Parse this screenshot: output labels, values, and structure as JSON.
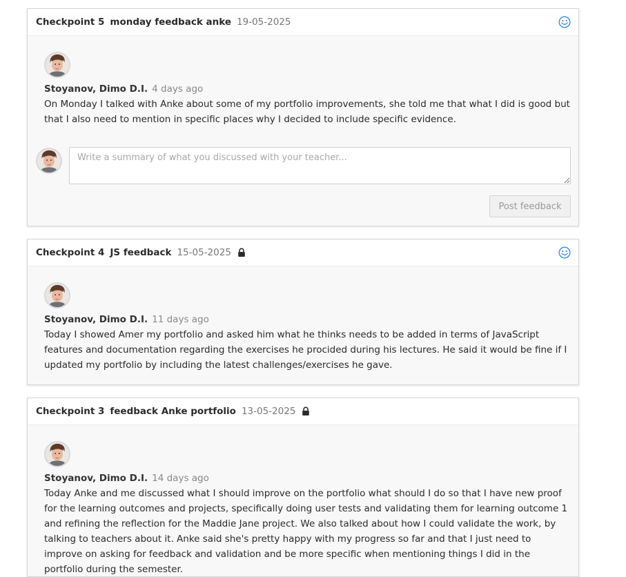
{
  "checkpoints": [
    {
      "label": "Checkpoint 5",
      "name": "monday feedback anke",
      "date": "19-05-2025",
      "locked": false,
      "comments": [
        {
          "author": "Stoyanov, Dimo D.I.",
          "time": "4 days ago",
          "text": "On Monday I talked with Anke about some of my portfolio improvements, she told me that what I did is good but that I also need to mention in specific places why I decided to include specific evidence."
        }
      ],
      "reply": {
        "placeholder": "Write a summary of what you discussed with your teacher...",
        "value": "",
        "button_label": "Post feedback"
      }
    },
    {
      "label": "Checkpoint 4",
      "name": "JS feedback",
      "date": "15-05-2025",
      "locked": true,
      "comments": [
        {
          "author": "Stoyanov, Dimo D.I.",
          "time": "11 days ago",
          "text": "Today I showed Amer my portfolio and asked him what he thinks needs to be added in terms of JavaScript features and documentation regarding the exercises he procided during his lectures. He said it would be fine if I updated my portfolio by including the latest challenges/exercises he gave."
        }
      ]
    },
    {
      "label": "Checkpoint 3",
      "name": "feedback Anke portfolio",
      "date": "13-05-2025",
      "locked": true,
      "comments": [
        {
          "author": "Stoyanov, Dimo D.I.",
          "time": "14 days ago",
          "text": "Today Anke and me discussed what I should improve on the portfolio what should I do so that I have new proof for the learning outcomes and projects, specifically doing user tests and validating them for learning outcome 1 and refining the reflection for the Maddie Jane project. We also talked about how I could validate the work, by talking to teachers about it. Anke said she's pretty happy with my progress so far and that I just need to improve on asking for feedback and validation and be more specific when mentioning things I did in the portfolio during the semester."
        }
      ]
    }
  ],
  "colors": {
    "smiley": "#3d8bd9",
    "lock": "#2b2b2b"
  },
  "icons": {
    "smiley": "smiley-icon",
    "lock": "lock-icon",
    "avatar": "avatar"
  }
}
